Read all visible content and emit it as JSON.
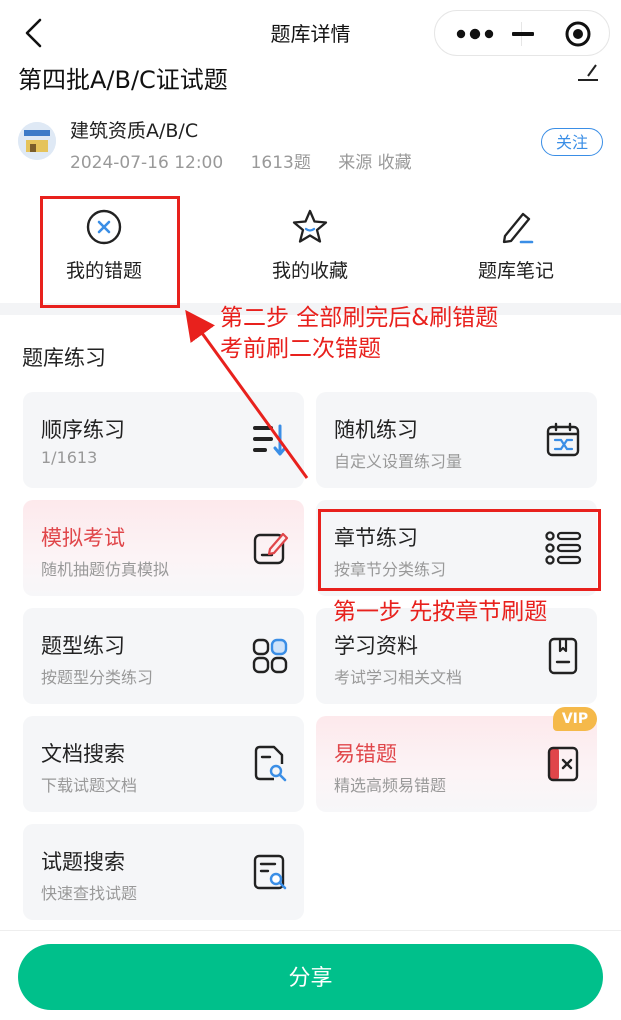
{
  "nav": {
    "title": "题库详情"
  },
  "bank": {
    "title": "第四批A/B/C证试题",
    "org": "建筑资质A/B/C",
    "date": "2024-07-16 12:00",
    "count": "1613题",
    "source": "来源 收藏",
    "follow_label": "关注"
  },
  "actions": {
    "wrong": "我的错题",
    "fav": "我的收藏",
    "notes": "题库笔记"
  },
  "section": {
    "title": "题库练习"
  },
  "cards": {
    "seq": {
      "title": "顺序练习",
      "sub": "1/1613"
    },
    "random": {
      "title": "随机练习",
      "sub": "自定义设置练习量"
    },
    "mock": {
      "title": "模拟考试",
      "sub": "随机抽题仿真模拟"
    },
    "chapter": {
      "title": "章节练习",
      "sub": "按章节分类练习"
    },
    "type": {
      "title": "题型练习",
      "sub": "按题型分类练习"
    },
    "material": {
      "title": "学习资料",
      "sub": "考试学习相关文档"
    },
    "docsearch": {
      "title": "文档搜索",
      "sub": "下载试题文档"
    },
    "error": {
      "title": "易错题",
      "sub": "精选高频易错题",
      "badge": "VIP"
    },
    "qsearch": {
      "title": "试题搜索",
      "sub": "快速查找试题"
    }
  },
  "share_label": "分享",
  "annotations": {
    "step2_line1": "第二步 全部刷完后&刷错题",
    "step2_line2": "考前刷二次错题",
    "step1": "第一步 先按章节刷题"
  },
  "colors": {
    "accent": "#00c08b",
    "annotation": "#e8211d",
    "link": "#3a8ee6",
    "vip": "#f5b94a"
  }
}
